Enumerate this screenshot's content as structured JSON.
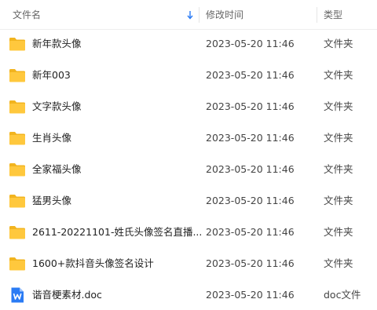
{
  "header": {
    "name_label": "文件名",
    "date_label": "修改时间",
    "type_label": "类型"
  },
  "colors": {
    "folder": "#FFC83D",
    "folder_back": "#F2B41F",
    "doc_blue": "#2A7BF4",
    "sort_arrow": "#2A7BF4"
  },
  "rows": [
    {
      "name": "新年款头像",
      "date": "2023-05-20 11:46",
      "type": "文件夹",
      "icon": "folder-icon"
    },
    {
      "name": "新年003",
      "date": "2023-05-20 11:46",
      "type": "文件夹",
      "icon": "folder-icon"
    },
    {
      "name": "文字款头像",
      "date": "2023-05-20 11:46",
      "type": "文件夹",
      "icon": "folder-icon"
    },
    {
      "name": "生肖头像",
      "date": "2023-05-20 11:46",
      "type": "文件夹",
      "icon": "folder-icon"
    },
    {
      "name": "全家福头像",
      "date": "2023-05-20 11:46",
      "type": "文件夹",
      "icon": "folder-icon"
    },
    {
      "name": "猛男头像",
      "date": "2023-05-20 11:46",
      "type": "文件夹",
      "icon": "folder-icon"
    },
    {
      "name": "2611-20221101-姓氏头像签名直播...",
      "date": "2023-05-20 11:46",
      "type": "文件夹",
      "icon": "folder-icon"
    },
    {
      "name": "1600+款抖音头像签名设计",
      "date": "2023-05-20 11:46",
      "type": "文件夹",
      "icon": "folder-icon"
    },
    {
      "name": "谐音梗素材.doc",
      "date": "2023-05-20 11:46",
      "type": "doc文件",
      "icon": "word-doc-icon"
    }
  ]
}
